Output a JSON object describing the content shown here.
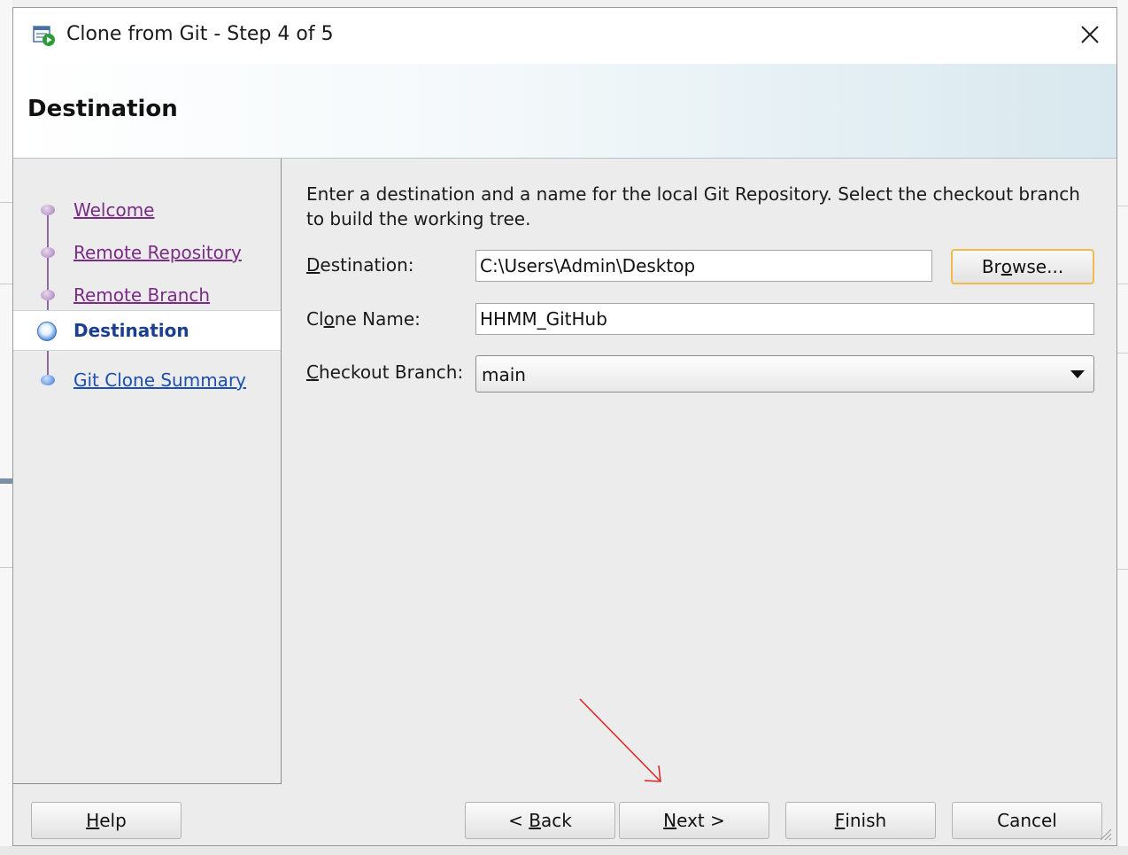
{
  "window": {
    "title": "Clone from Git - Step 4 of 5",
    "icon": "git-clone-icon",
    "close_icon": "close-icon"
  },
  "header": {
    "title": "Destination"
  },
  "steps": [
    {
      "label": "Welcome",
      "state": "visited"
    },
    {
      "label": "Remote Repository",
      "state": "visited"
    },
    {
      "label": "Remote Branch",
      "state": "visited"
    },
    {
      "label": "Destination",
      "state": "current"
    },
    {
      "label": "Git Clone Summary",
      "state": "pending"
    }
  ],
  "content": {
    "intro": "Enter a destination and a name for the local Git Repository. Select the checkout branch to build the working tree.",
    "destination": {
      "label_pre": "",
      "label_key": "D",
      "label_post": "estination:",
      "value": "C:\\Users\\Admin\\Desktop"
    },
    "browse": {
      "pre": "Br",
      "key": "o",
      "post": "wse..."
    },
    "clone_name": {
      "label_pre": "Cl",
      "label_key": "o",
      "label_post": "ne Name:",
      "value": "HHMM_GitHub"
    },
    "checkout_branch": {
      "label_pre": "",
      "label_key": "C",
      "label_post": "heckout Branch:",
      "value": "main"
    }
  },
  "buttons": {
    "help": {
      "pre": "",
      "key": "H",
      "post": "elp"
    },
    "back": {
      "pre": "< ",
      "key": "B",
      "post": "ack"
    },
    "next": {
      "pre": "",
      "key": "N",
      "post": "ext >"
    },
    "finish": {
      "pre": "",
      "key": "F",
      "post": "inish"
    },
    "cancel": {
      "label": "Cancel"
    }
  },
  "colors": {
    "visited_link": "#7b2c87",
    "pending_link": "#1b4fb0",
    "current_step": "#1b3f8f",
    "browse_focus": "#f2b94e",
    "annotation_arrow": "#e02020"
  }
}
